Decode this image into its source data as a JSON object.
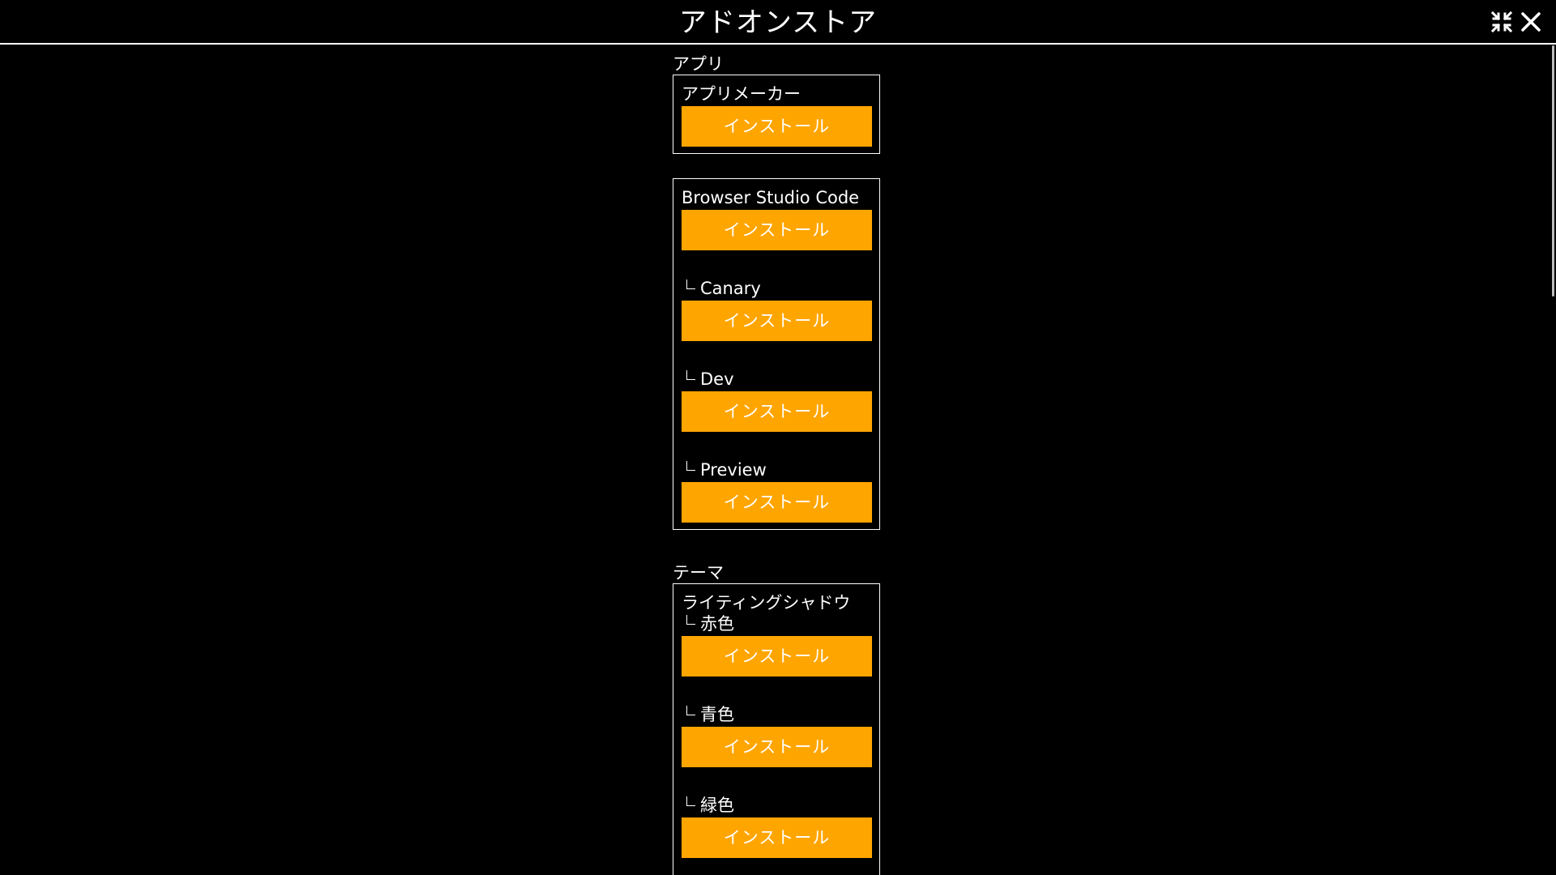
{
  "window": {
    "title": "アドオンストア",
    "shrink_icon": "shrink-icon",
    "close_icon": "close-icon"
  },
  "colors": {
    "background": "#000000",
    "text": "#ffffff",
    "install_button": "#ffa500",
    "scrollbar_thumb": "#bdbdbd"
  },
  "sections": [
    {
      "label": "アプリ",
      "cards": [
        {
          "name": "アプリメーカー",
          "install_label": "インストール"
        },
        {
          "name": "Browser Studio Code",
          "install_label": "インストール",
          "variants": [
            {
              "name": "Canary",
              "install_label": "インストール"
            },
            {
              "name": "Dev",
              "install_label": "インストール"
            },
            {
              "name": "Preview",
              "install_label": "インストール"
            }
          ]
        }
      ]
    },
    {
      "label": "テーマ",
      "cards": [
        {
          "name": "ライティングシャドウ",
          "variants": [
            {
              "name": "赤色",
              "install_label": "インストール"
            },
            {
              "name": "青色",
              "install_label": "インストール"
            },
            {
              "name": "緑色",
              "install_label": "インストール"
            }
          ]
        }
      ]
    }
  ]
}
